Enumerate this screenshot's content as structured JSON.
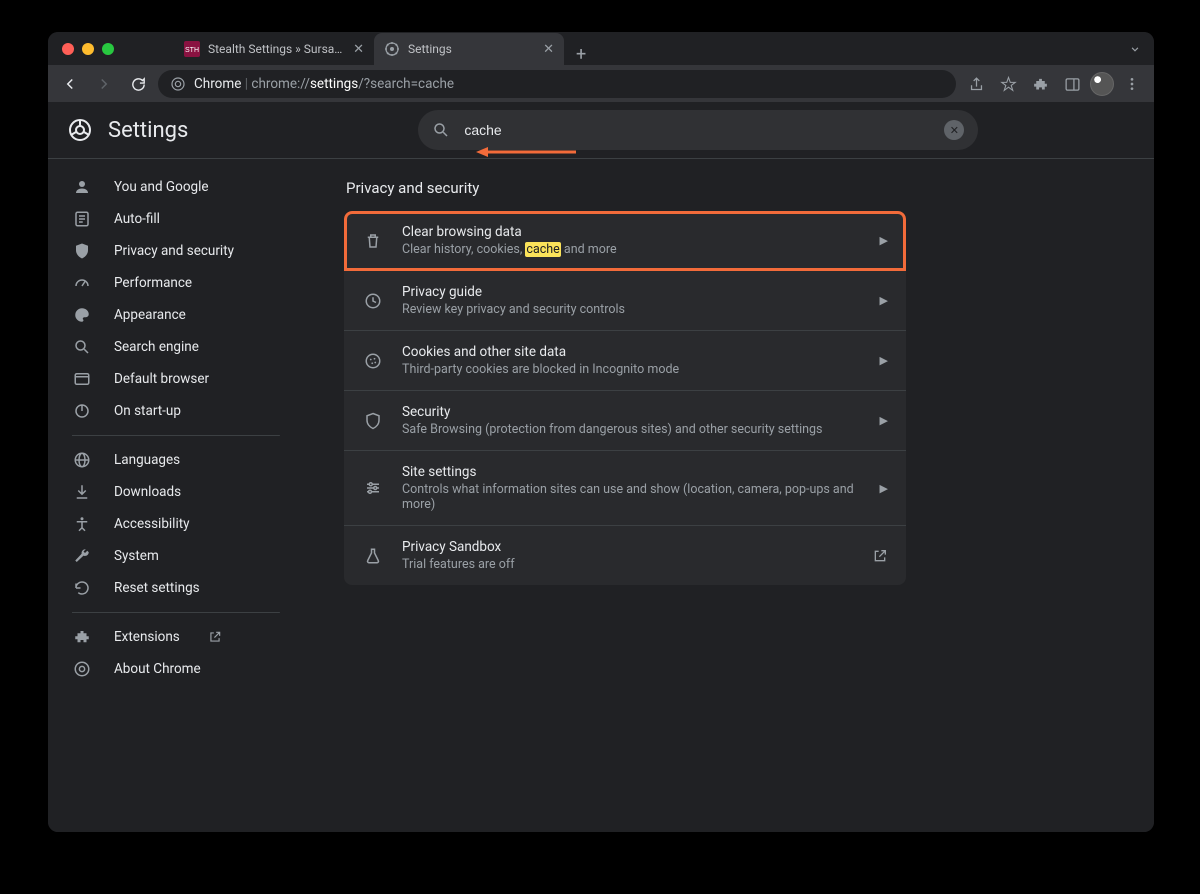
{
  "tabs": [
    {
      "label": "Stealth Settings » Sursa de tut"
    },
    {
      "label": "Settings"
    }
  ],
  "url": {
    "prefix": "Chrome",
    "scheme": "chrome://",
    "bold": "settings",
    "rest": "/?search=cache"
  },
  "header": {
    "title": "Settings"
  },
  "search": {
    "value": "cache"
  },
  "sidebar": {
    "items": [
      {
        "label": "You and Google"
      },
      {
        "label": "Auto-fill"
      },
      {
        "label": "Privacy and security"
      },
      {
        "label": "Performance"
      },
      {
        "label": "Appearance"
      },
      {
        "label": "Search engine"
      },
      {
        "label": "Default browser"
      },
      {
        "label": "On start-up"
      }
    ],
    "advanced": [
      {
        "label": "Languages"
      },
      {
        "label": "Downloads"
      },
      {
        "label": "Accessibility"
      },
      {
        "label": "System"
      },
      {
        "label": "Reset settings"
      }
    ],
    "footer": [
      {
        "label": "Extensions"
      },
      {
        "label": "About Chrome"
      }
    ]
  },
  "section_title": "Privacy and security",
  "rows": [
    {
      "title": "Clear browsing data",
      "sub_pre": "Clear history, cookies, ",
      "sub_hl": "cache",
      "sub_post": " and more"
    },
    {
      "title": "Privacy guide",
      "sub": "Review key privacy and security controls"
    },
    {
      "title": "Cookies and other site data",
      "sub": "Third-party cookies are blocked in Incognito mode"
    },
    {
      "title": "Security",
      "sub": "Safe Browsing (protection from dangerous sites) and other security settings"
    },
    {
      "title": "Site settings",
      "sub": "Controls what information sites can use and show (location, camera, pop-ups and more)"
    },
    {
      "title": "Privacy Sandbox",
      "sub": "Trial features are off"
    }
  ]
}
